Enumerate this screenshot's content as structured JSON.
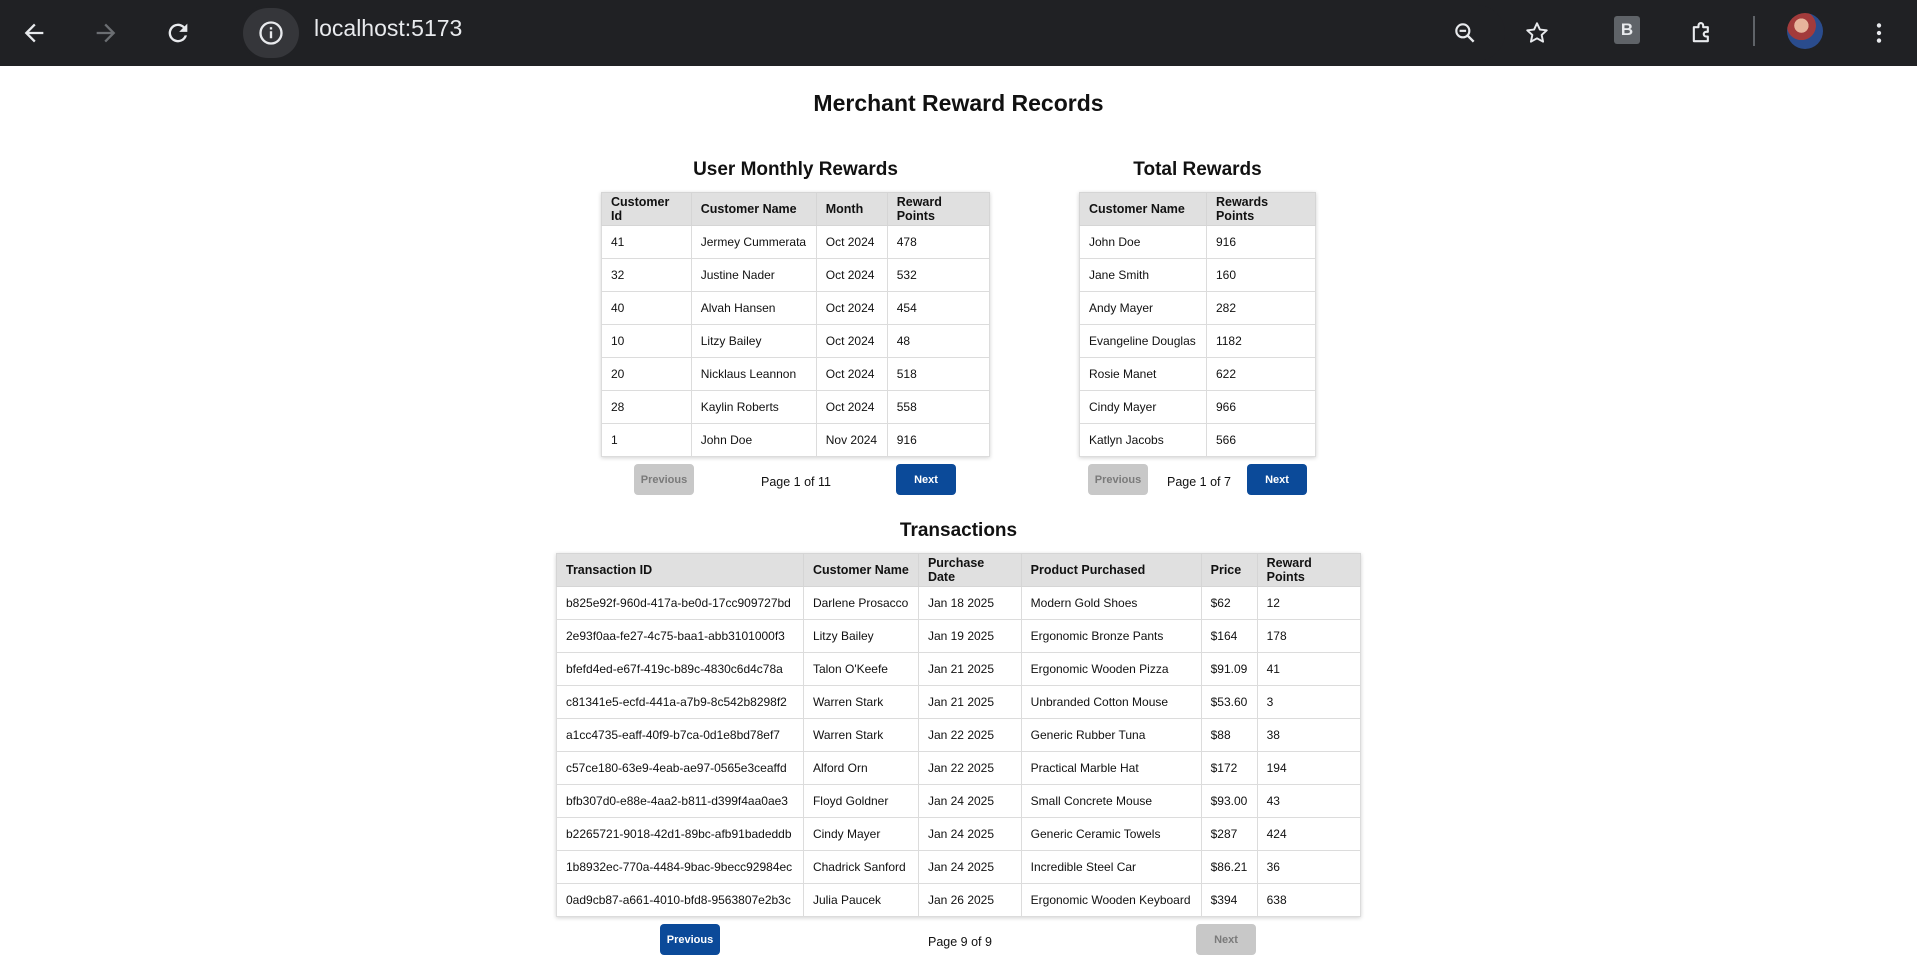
{
  "browser": {
    "url": "localhost:5173",
    "extension_badge": "B"
  },
  "page": {
    "title": "Merchant Reward Records"
  },
  "monthly": {
    "title": "User Monthly Rewards",
    "headers": [
      "Customer Id",
      "Customer Name",
      "Month",
      "Reward Points"
    ],
    "rows": [
      [
        "41",
        "Jermey Cummerata",
        "Oct 2024",
        "478"
      ],
      [
        "32",
        "Justine Nader",
        "Oct 2024",
        "532"
      ],
      [
        "40",
        "Alvah Hansen",
        "Oct 2024",
        "454"
      ],
      [
        "10",
        "Litzy Bailey",
        "Oct 2024",
        "48"
      ],
      [
        "20",
        "Nicklaus Leannon",
        "Oct 2024",
        "518"
      ],
      [
        "28",
        "Kaylin Roberts",
        "Oct 2024",
        "558"
      ],
      [
        "1",
        "John Doe",
        "Nov 2024",
        "916"
      ]
    ],
    "prev_label": "Previous",
    "next_label": "Next",
    "page_label": "Page 1 of 11"
  },
  "total": {
    "title": "Total Rewards",
    "headers": [
      "Customer Name",
      "Rewards Points"
    ],
    "rows": [
      [
        "John Doe",
        "916"
      ],
      [
        "Jane Smith",
        "160"
      ],
      [
        "Andy Mayer",
        "282"
      ],
      [
        "Evangeline Douglas",
        "1182"
      ],
      [
        "Rosie Manet",
        "622"
      ],
      [
        "Cindy Mayer",
        "966"
      ],
      [
        "Katlyn Jacobs",
        "566"
      ]
    ],
    "prev_label": "Previous",
    "next_label": "Next",
    "page_label": "Page 1 of 7"
  },
  "transactions": {
    "title": "Transactions",
    "headers": [
      "Transaction ID",
      "Customer Name",
      "Purchase Date",
      "Product Purchased",
      "Price",
      "Reward Points"
    ],
    "rows": [
      [
        "b825e92f-960d-417a-be0d-17cc909727bd",
        "Darlene Prosacco",
        "Jan 18 2025",
        "Modern Gold Shoes",
        "$62",
        "12"
      ],
      [
        "2e93f0aa-fe27-4c75-baa1-abb3101000f3",
        "Litzy Bailey",
        "Jan 19 2025",
        "Ergonomic Bronze Pants",
        "$164",
        "178"
      ],
      [
        "bfefd4ed-e67f-419c-b89c-4830c6d4c78a",
        "Talon O'Keefe",
        "Jan 21 2025",
        "Ergonomic Wooden Pizza",
        "$91.09",
        "41"
      ],
      [
        "c81341e5-ecfd-441a-a7b9-8c542b8298f2",
        "Warren Stark",
        "Jan 21 2025",
        "Unbranded Cotton Mouse",
        "$53.60",
        "3"
      ],
      [
        "a1cc4735-eaff-40f9-b7ca-0d1e8bd78ef7",
        "Warren Stark",
        "Jan 22 2025",
        "Generic Rubber Tuna",
        "$88",
        "38"
      ],
      [
        "c57ce180-63e9-4eab-ae97-0565e3ceaffd",
        "Alford Orn",
        "Jan 22 2025",
        "Practical Marble Hat",
        "$172",
        "194"
      ],
      [
        "bfb307d0-e88e-4aa2-b811-d399f4aa0ae3",
        "Floyd Goldner",
        "Jan 24 2025",
        "Small Concrete Mouse",
        "$93.00",
        "43"
      ],
      [
        "b2265721-9018-42d1-89bc-afb91badeddb",
        "Cindy Mayer",
        "Jan 24 2025",
        "Generic Ceramic Towels",
        "$287",
        "424"
      ],
      [
        "1b8932ec-770a-4484-9bac-9becc92984ec",
        "Chadrick Sanford",
        "Jan 24 2025",
        "Incredible Steel Car",
        "$86.21",
        "36"
      ],
      [
        "0ad9cb87-a661-4010-bfd8-9563807e2b3c",
        "Julia Paucek",
        "Jan 26 2025",
        "Ergonomic Wooden Keyboard",
        "$394",
        "638"
      ]
    ],
    "prev_label": "Previous",
    "next_label": "Next",
    "page_label": "Page 9 of 9"
  }
}
